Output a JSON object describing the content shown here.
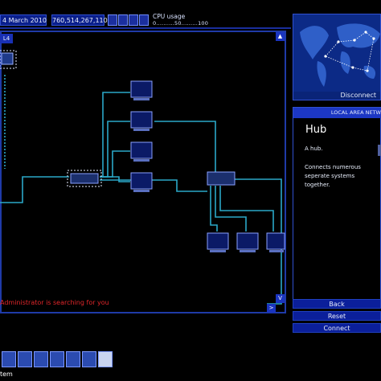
{
  "topbar": {
    "date": "4 March 2010",
    "money": "760,514,267,110",
    "cpu_label": "CPU usage",
    "cpu_scale": "0..........50.........100"
  },
  "network": {
    "lan_label": "L4",
    "status_message": "Administrator is searching for you",
    "scroll_up": "▲",
    "scroll_down": "V",
    "scroll_right": ">"
  },
  "map": {
    "disconnect_label": "Disconnect"
  },
  "panel": {
    "title": "LOCAL AREA NETW",
    "node_title": "Hub",
    "node_type": "A hub.",
    "node_description": "Connects numerous seperate systems together."
  },
  "actions": {
    "back_label": "Back",
    "reset_label": "Reset",
    "connect_label": "Connect"
  },
  "taskbar": {
    "bottom_label": "tem"
  },
  "colors": {
    "accent_blue": "#1c37c4",
    "line_cyan": "#2aa8c8",
    "alert_red": "#e2262a"
  }
}
